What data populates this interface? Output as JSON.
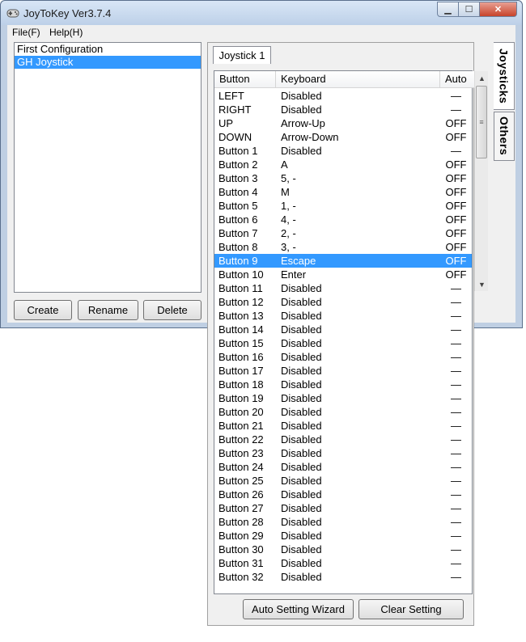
{
  "window": {
    "title": "JoyToKey Ver3.7.4"
  },
  "menu": {
    "file": "File(F)",
    "help": "Help(H)"
  },
  "profiles": [
    {
      "name": "First Configuration",
      "selected": false
    },
    {
      "name": "GH Joystick",
      "selected": true
    }
  ],
  "profile_buttons": {
    "create": "Create",
    "rename": "Rename",
    "delete": "Delete"
  },
  "side_tabs": {
    "joysticks": "Joysticks",
    "others": "Others"
  },
  "joystick_tab": "Joystick 1",
  "columns": {
    "button": "Button",
    "keyboard": "Keyboard",
    "auto": "Auto"
  },
  "rows": [
    {
      "button": "LEFT",
      "keyboard": "Disabled",
      "auto": "—"
    },
    {
      "button": "RIGHT",
      "keyboard": "Disabled",
      "auto": "—"
    },
    {
      "button": "UP",
      "keyboard": "Arrow-Up",
      "auto": "OFF"
    },
    {
      "button": "DOWN",
      "keyboard": "Arrow-Down",
      "auto": "OFF"
    },
    {
      "button": "Button 1",
      "keyboard": "Disabled",
      "auto": "—"
    },
    {
      "button": "Button 2",
      "keyboard": "A",
      "auto": "OFF"
    },
    {
      "button": "Button 3",
      "keyboard": "5, -",
      "auto": "OFF"
    },
    {
      "button": "Button 4",
      "keyboard": "M",
      "auto": "OFF"
    },
    {
      "button": "Button 5",
      "keyboard": "1, -",
      "auto": "OFF"
    },
    {
      "button": "Button 6",
      "keyboard": "4, -",
      "auto": "OFF"
    },
    {
      "button": "Button 7",
      "keyboard": "2, -",
      "auto": "OFF"
    },
    {
      "button": "Button 8",
      "keyboard": "3, -",
      "auto": "OFF"
    },
    {
      "button": "Button 9",
      "keyboard": "Escape",
      "auto": "OFF",
      "selected": true
    },
    {
      "button": "Button 10",
      "keyboard": "Enter",
      "auto": "OFF"
    },
    {
      "button": "Button 11",
      "keyboard": "Disabled",
      "auto": "—"
    },
    {
      "button": "Button 12",
      "keyboard": "Disabled",
      "auto": "—"
    },
    {
      "button": "Button 13",
      "keyboard": "Disabled",
      "auto": "—"
    },
    {
      "button": "Button 14",
      "keyboard": "Disabled",
      "auto": "—"
    },
    {
      "button": "Button 15",
      "keyboard": "Disabled",
      "auto": "—"
    },
    {
      "button": "Button 16",
      "keyboard": "Disabled",
      "auto": "—"
    },
    {
      "button": "Button 17",
      "keyboard": "Disabled",
      "auto": "—"
    },
    {
      "button": "Button 18",
      "keyboard": "Disabled",
      "auto": "—"
    },
    {
      "button": "Button 19",
      "keyboard": "Disabled",
      "auto": "—"
    },
    {
      "button": "Button 20",
      "keyboard": "Disabled",
      "auto": "—"
    },
    {
      "button": "Button 21",
      "keyboard": "Disabled",
      "auto": "—"
    },
    {
      "button": "Button 22",
      "keyboard": "Disabled",
      "auto": "—"
    },
    {
      "button": "Button 23",
      "keyboard": "Disabled",
      "auto": "—"
    },
    {
      "button": "Button 24",
      "keyboard": "Disabled",
      "auto": "—"
    },
    {
      "button": "Button 25",
      "keyboard": "Disabled",
      "auto": "—"
    },
    {
      "button": "Button 26",
      "keyboard": "Disabled",
      "auto": "—"
    },
    {
      "button": "Button 27",
      "keyboard": "Disabled",
      "auto": "—"
    },
    {
      "button": "Button 28",
      "keyboard": "Disabled",
      "auto": "—"
    },
    {
      "button": "Button 29",
      "keyboard": "Disabled",
      "auto": "—"
    },
    {
      "button": "Button 30",
      "keyboard": "Disabled",
      "auto": "—"
    },
    {
      "button": "Button 31",
      "keyboard": "Disabled",
      "auto": "—"
    },
    {
      "button": "Button 32",
      "keyboard": "Disabled",
      "auto": "—"
    }
  ],
  "bottom_buttons": {
    "wizard": "Auto Setting Wizard",
    "clear": "Clear Setting"
  },
  "colors": {
    "selection": "#3399ff",
    "frame": "#bfcfe3",
    "close_button": "#c7432a"
  },
  "icons": {
    "app": "gamepad-icon",
    "minimize": "minimize-icon",
    "maximize": "maximize-icon",
    "close": "close-icon",
    "scroll_up": "arrow-up-icon",
    "scroll_down": "arrow-down-icon",
    "scroll_grip": "grip-icon"
  }
}
